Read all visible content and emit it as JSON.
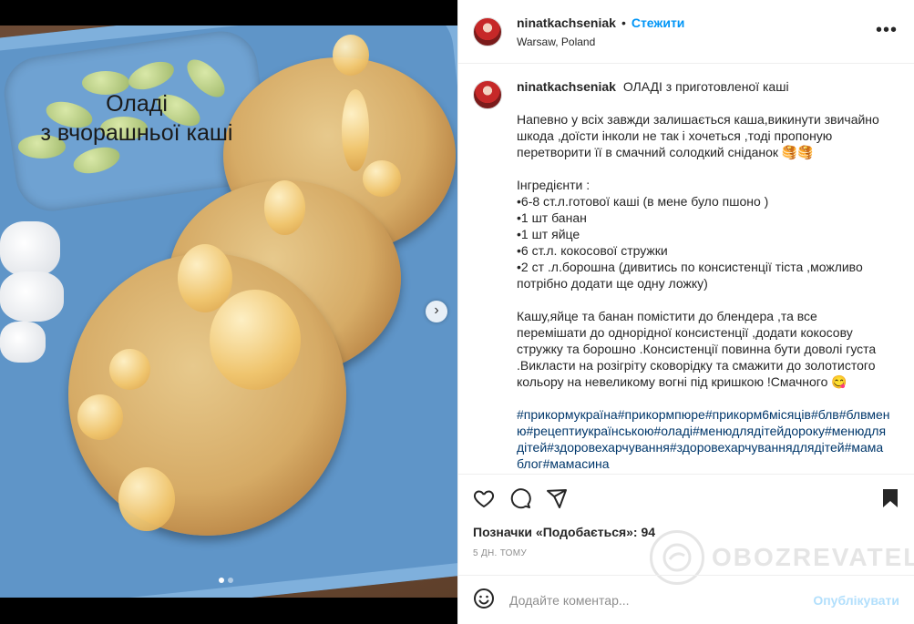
{
  "post": {
    "username": "ninatkachseniak",
    "separator": "•",
    "follow_label": "Стежити",
    "location": "Warsaw, Poland",
    "more_label": "•••"
  },
  "image": {
    "overlay_text_line1": "Оладі",
    "overlay_text_line2": "з вчорашньої каші",
    "next_icon": "chevron-right-icon",
    "carousel_count": 2,
    "carousel_active": 1
  },
  "caption": {
    "username": "ninatkachseniak",
    "title": "ОЛАДІ з приготовленої каші",
    "intro": "Напевно у всіх завжди залишається каша,викинути звичайно шкода ,доїсти інколи не так і хочеться ,тоді пропоную перетворити її в смачний солодкий сніданок 🥞🥞",
    "ingredients": "Інгредієнти :\n•6-8 ст.л.готової каші (в мене було пшоно )\n•1 шт банан\n•1 шт яйце\n•6 ст.л. кокосової стружки\n•2 ст .л.борошна (дивитись по консистенції тіста ,можливо потрібно додати ще одну ложку)",
    "method": "Кашу,яйце та банан помістити до блендера ,та все перемішати до однорідної консистенції ,додати кокосову стружку та борошно .Консистенції повинна бути доволі густа .Викласти на розігріту сковорідку та смажити до золотистого кольору на невеликому вогні під кришкою !Смачного 😋",
    "hashtags": "#прикормукраїна#прикормпюре#прикорм6місяців#блв#блвменю#рецептиукраїнською#оладі#менюдлядітейдороку#менюдлядітей#здоровехарчування#здоровехарчуваннядлядітей#мамаблог#мамасина"
  },
  "actions": {
    "like_icon": "heart-icon",
    "comment_icon": "comment-icon",
    "share_icon": "share-icon",
    "save_icon": "bookmark-icon"
  },
  "likes_text": "Позначки «Подобається»: 94",
  "time_text": "5 ДН. ТОМУ",
  "watermark": "OBOZREVATEL",
  "comment_box": {
    "emoji_icon": "emoji-icon",
    "placeholder": "Додайте коментар...",
    "publish_label": "Опублікувати"
  },
  "colors": {
    "link": "#0095f6",
    "hashtag": "#00376b",
    "publish_disabled": "#b2dffc",
    "muted": "#8e8e8e"
  }
}
